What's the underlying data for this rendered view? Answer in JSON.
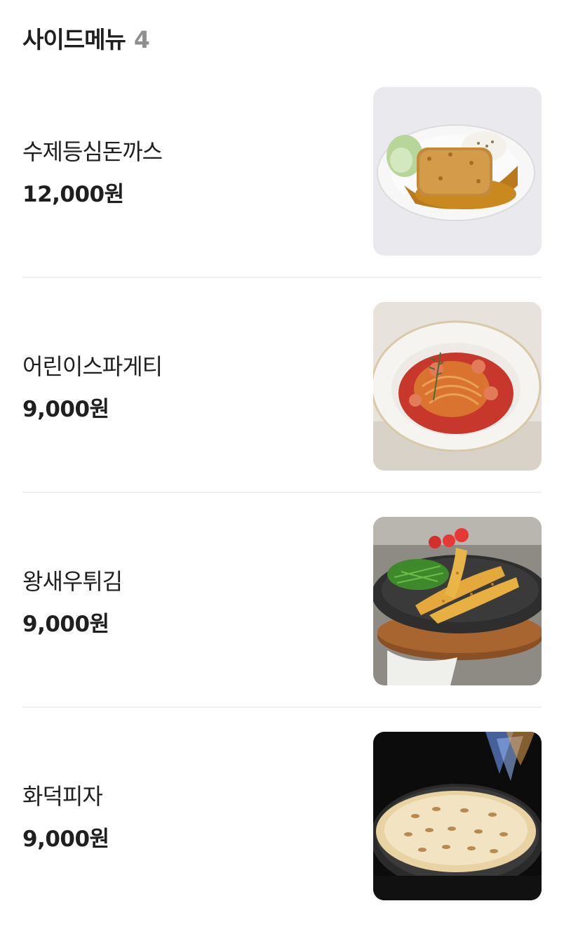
{
  "section": {
    "title": "사이드메뉴",
    "count": "4"
  },
  "menu": [
    {
      "name": "수제등심돈까스",
      "price": "12,000원",
      "image": "pork-cutlet-photo"
    },
    {
      "name": "어린이스파게티",
      "price": "9,000원",
      "image": "spaghetti-photo"
    },
    {
      "name": "왕새우튀김",
      "price": "9,000원",
      "image": "fried-shrimp-photo"
    },
    {
      "name": "화덕피자",
      "price": "9,000원",
      "image": "pizza-photo"
    }
  ]
}
